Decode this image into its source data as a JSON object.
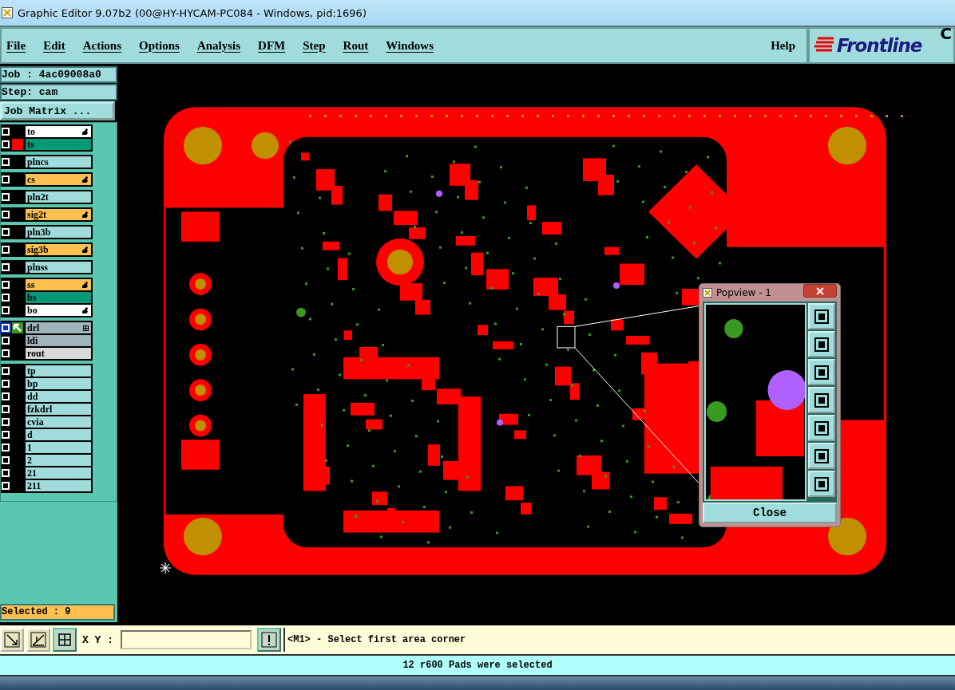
{
  "window": {
    "title": "Graphic Editor 9.07b2 (00@HY-HYCAM-PC084 - Windows, pid:1696)"
  },
  "menu": [
    "File",
    "Edit",
    "Actions",
    "Options",
    "Analysis",
    "DFM",
    "Step",
    "Rout",
    "Windows"
  ],
  "help": "Help",
  "logo": {
    "text": "Frontline",
    "corner": "C"
  },
  "job": "Job : 4ac09008a0",
  "step": "Step: cam",
  "job_matrix_button": "Job Matrix ...",
  "layer_groups": [
    [
      {
        "name": "to",
        "color": "#ffffff",
        "affected": true,
        "kind": "plain",
        "checked": false
      },
      {
        "name": "ts",
        "color": "#009977",
        "affected": false,
        "kind": "displayed",
        "checked": false
      }
    ],
    [
      {
        "name": "plncs",
        "color": "#a0dcdc",
        "affected": false,
        "kind": "plain",
        "checked": false
      }
    ],
    [
      {
        "name": "cs",
        "color": "#ffc050",
        "affected": true,
        "kind": "plain",
        "checked": false
      }
    ],
    [
      {
        "name": "pln2t",
        "color": "#a0dcdc",
        "affected": false,
        "kind": "plain",
        "checked": false
      }
    ],
    [
      {
        "name": "sig2t",
        "color": "#ffc050",
        "affected": true,
        "kind": "plain",
        "checked": false
      }
    ],
    [
      {
        "name": "pln3b",
        "color": "#a0dcdc",
        "affected": false,
        "kind": "plain",
        "checked": false
      }
    ],
    [
      {
        "name": "sig3b",
        "color": "#ffc050",
        "affected": true,
        "kind": "plain",
        "checked": false
      }
    ],
    [
      {
        "name": "plnss",
        "color": "#a0dcdc",
        "affected": false,
        "kind": "plain",
        "checked": false
      }
    ],
    [
      {
        "name": "ss",
        "color": "#ffc050",
        "affected": true,
        "kind": "plain",
        "checked": false
      },
      {
        "name": "bs",
        "color": "#009977",
        "affected": false,
        "kind": "plain",
        "checked": false
      },
      {
        "name": "bo",
        "color": "#ffffff",
        "affected": true,
        "kind": "plain",
        "checked": false
      }
    ],
    [
      {
        "name": "drl",
        "color": "#a0b4bc",
        "affected": false,
        "kind": "work",
        "checked": false
      },
      {
        "name": "ldi",
        "color": "#a0b4bc",
        "affected": false,
        "kind": "plain",
        "checked": false
      },
      {
        "name": "rout",
        "color": "#d8d8d8",
        "affected": false,
        "kind": "plain",
        "checked": false
      }
    ],
    [
      {
        "name": "tp",
        "color": "#a0dcdc",
        "affected": false,
        "kind": "plain",
        "checked": false
      },
      {
        "name": "bp",
        "color": "#a0dcdc",
        "affected": false,
        "kind": "plain",
        "checked": false
      },
      {
        "name": "dd",
        "color": "#a0dcdc",
        "affected": false,
        "kind": "plain",
        "checked": false
      },
      {
        "name": "fzkdrl",
        "color": "#a0dcdc",
        "affected": false,
        "kind": "plain",
        "checked": false
      },
      {
        "name": "cvia",
        "color": "#a0dcdc",
        "affected": false,
        "kind": "plain",
        "checked": false
      },
      {
        "name": "d",
        "color": "#a0dcdc",
        "affected": false,
        "kind": "plain",
        "checked": false
      },
      {
        "name": "1",
        "color": "#a0dcdc",
        "affected": false,
        "kind": "plain",
        "checked": false
      },
      {
        "name": "2",
        "color": "#a0dcdc",
        "affected": false,
        "kind": "plain",
        "checked": false
      },
      {
        "name": "21",
        "color": "#a0dcdc",
        "affected": false,
        "kind": "plain",
        "checked": false
      },
      {
        "name": "211",
        "color": "#a0dcdc",
        "affected": false,
        "kind": "plain",
        "checked": false
      }
    ]
  ],
  "selected_count": "Selected : 9",
  "coords": {
    "label": "X Y :"
  },
  "prompt": "<M1> - Select first area corner",
  "status": "12 r600 Pads were selected",
  "popview": {
    "title": "Popview - 1",
    "close": "Close"
  }
}
